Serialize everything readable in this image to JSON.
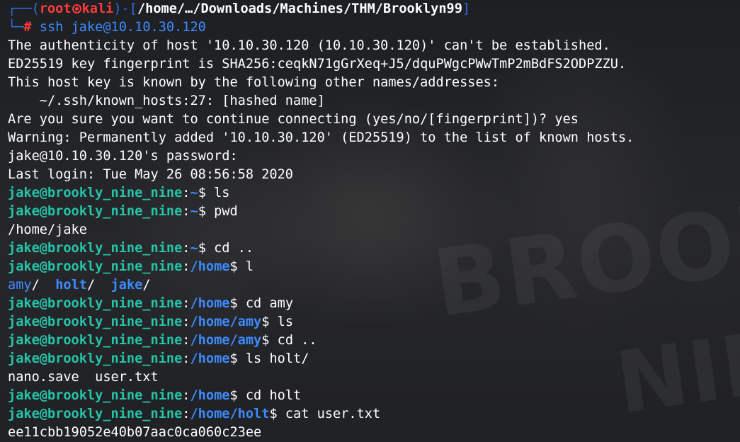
{
  "prompt_header": {
    "top_left": "┌──(",
    "user": "root",
    "host": "kali",
    "mid": ")-[",
    "cwd": "/home/…/Downloads/Machines/THM/Brooklyn99",
    "close": "]",
    "bottom_left": "└─",
    "hash": "#",
    "command": "ssh jake@10.10.30.120"
  },
  "ssh_output": [
    "The authenticity of host '10.10.30.120 (10.10.30.120)' can't be established.",
    "ED25519 key fingerprint is SHA256:ceqkN71gGrXeq+J5/dquPWgcPWwTmP2mBdFS2ODPZZU.",
    "This host key is known by the following other names/addresses:",
    "    ~/.ssh/known_hosts:27: [hashed name]",
    "Are you sure you want to continue connecting (yes/no/[fingerprint])? yes",
    "Warning: Permanently added '10.10.30.120' (ED25519) to the list of known hosts.",
    "jake@10.10.30.120's password:",
    "Last login: Tue May 26 08:56:58 2020"
  ],
  "remote_prompt_user": "jake@brookly_nine_nine",
  "sessions": [
    {
      "path": "~",
      "command": " ls"
    },
    {
      "path": "~",
      "command": " pwd"
    },
    {
      "output": "/home/jake"
    },
    {
      "path": "~",
      "command": " cd .."
    },
    {
      "path": "/home",
      "command": " l"
    },
    {
      "dirs": [
        "amy",
        "holt",
        "jake"
      ]
    },
    {
      "path": "/home",
      "command": " cd amy"
    },
    {
      "path": "/home/amy",
      "command": " ls"
    },
    {
      "path": "/home/amy",
      "command": " cd .."
    },
    {
      "path": "/home",
      "command": " ls holt/"
    },
    {
      "output": "nano.save  user.txt"
    },
    {
      "path": "/home",
      "command": " cd holt"
    },
    {
      "path": "/home/holt",
      "command": " cat user.txt"
    },
    {
      "output": "ee11cbb19052e40b07aac0ca060c23ee"
    }
  ],
  "colors": {
    "background": "#202226",
    "frame_blue": "#2f6fe0",
    "root_red": "#ff3c3c",
    "prompt_green": "#26c4a8",
    "dir_blue": "#3d8bff",
    "text": "#ffffff"
  },
  "wallpaper": {
    "word_1": "BROOKLYN",
    "word_2": "NINE"
  }
}
